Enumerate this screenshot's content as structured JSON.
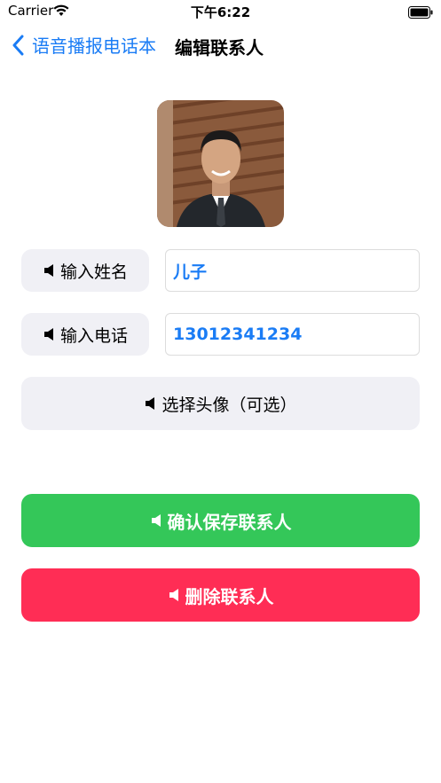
{
  "status_bar": {
    "carrier": "Carrier",
    "time": "下午6:22"
  },
  "nav": {
    "back_label": "语音播报电话本",
    "title": "编辑联系人"
  },
  "form": {
    "name_label": "输入姓名",
    "name_value": "儿子",
    "phone_label": "输入电话",
    "phone_value": "13012341234",
    "avatar_button": "选择头像（可选）"
  },
  "actions": {
    "save_label": "确认保存联系人",
    "delete_label": "删除联系人"
  },
  "colors": {
    "accent": "#1a7cf5",
    "save_bg": "#34c759",
    "delete_bg": "#ff2d55",
    "pill_bg": "#f0f0f5"
  },
  "icons": [
    "wifi-icon",
    "battery-icon",
    "back-chevron-icon",
    "speaker-icon"
  ]
}
